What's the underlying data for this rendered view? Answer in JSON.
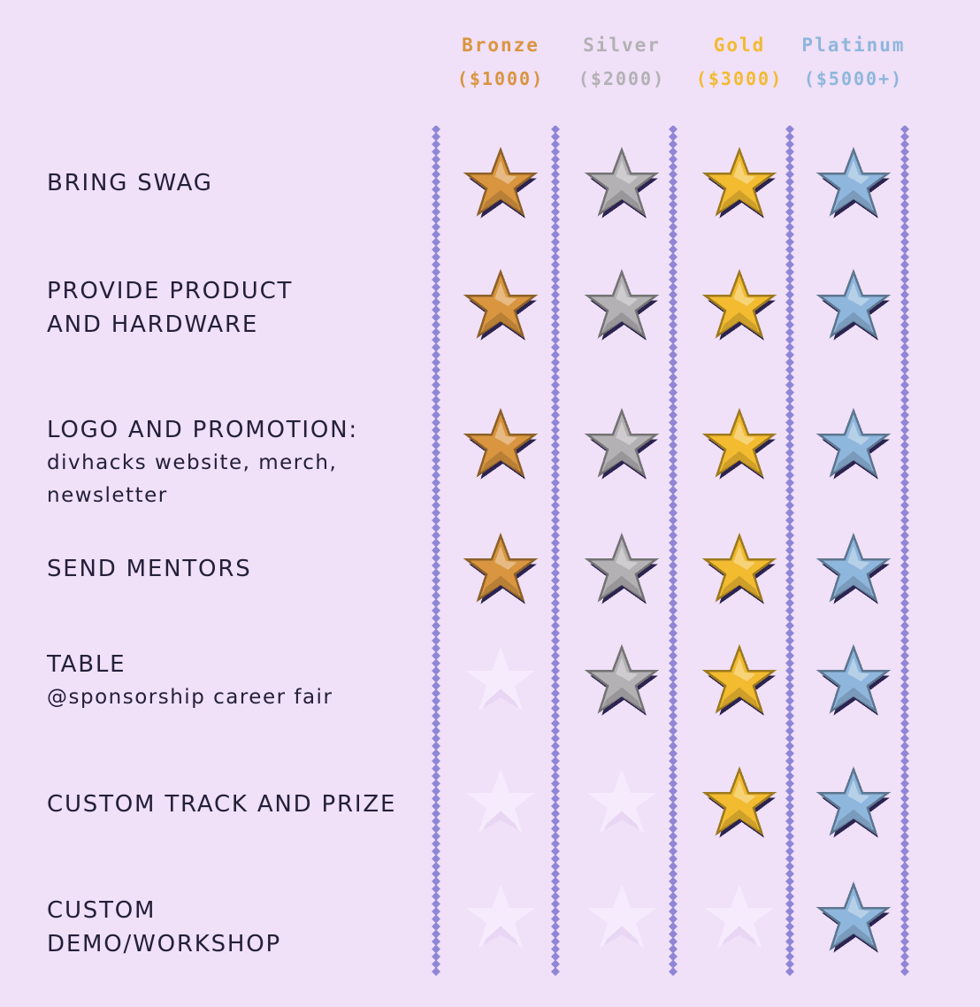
{
  "tiers": [
    {
      "key": "bronze",
      "name": "Bronze",
      "price": "($1000)",
      "color": "#d9953f"
    },
    {
      "key": "silver",
      "name": "Silver",
      "price": "($2000)",
      "color": "#b3b1b3"
    },
    {
      "key": "gold",
      "name": "Gold",
      "price": "($3000)",
      "color": "#f2bb30"
    },
    {
      "key": "platinum",
      "name": "Platinum",
      "price": "($5000+)",
      "color": "#8fb6dc"
    }
  ],
  "rows": [
    {
      "label": "BRING SWAG",
      "sub": "",
      "included": [
        true,
        true,
        true,
        true
      ]
    },
    {
      "label": "PROVIDE PRODUCT\nAND HARDWARE",
      "sub": "",
      "included": [
        true,
        true,
        true,
        true
      ]
    },
    {
      "label": "LOGO AND PROMOTION:",
      "sub": "divhacks website, merch,\nnewsletter",
      "included": [
        true,
        true,
        true,
        true
      ]
    },
    {
      "label": "SEND MENTORS",
      "sub": "",
      "included": [
        true,
        true,
        true,
        true
      ]
    },
    {
      "label": "TABLE",
      "sub": "@sponsorship career fair",
      "included": [
        false,
        true,
        true,
        true
      ]
    },
    {
      "label": "CUSTOM TRACK AND PRIZE",
      "sub": "",
      "included": [
        false,
        false,
        true,
        true
      ]
    },
    {
      "label": "CUSTOM\nDEMO/WORKSHOP",
      "sub": "",
      "included": [
        false,
        false,
        false,
        true
      ]
    }
  ],
  "colors": {
    "background": "#f0e0f8",
    "label_text": "#24203a",
    "divider": "#8f86d6",
    "star_outline": "#2b2350",
    "empty_star": "#f7ecfd"
  },
  "icons": {
    "star": "pixel-star-icon",
    "divider": "diamond-chain-divider"
  }
}
